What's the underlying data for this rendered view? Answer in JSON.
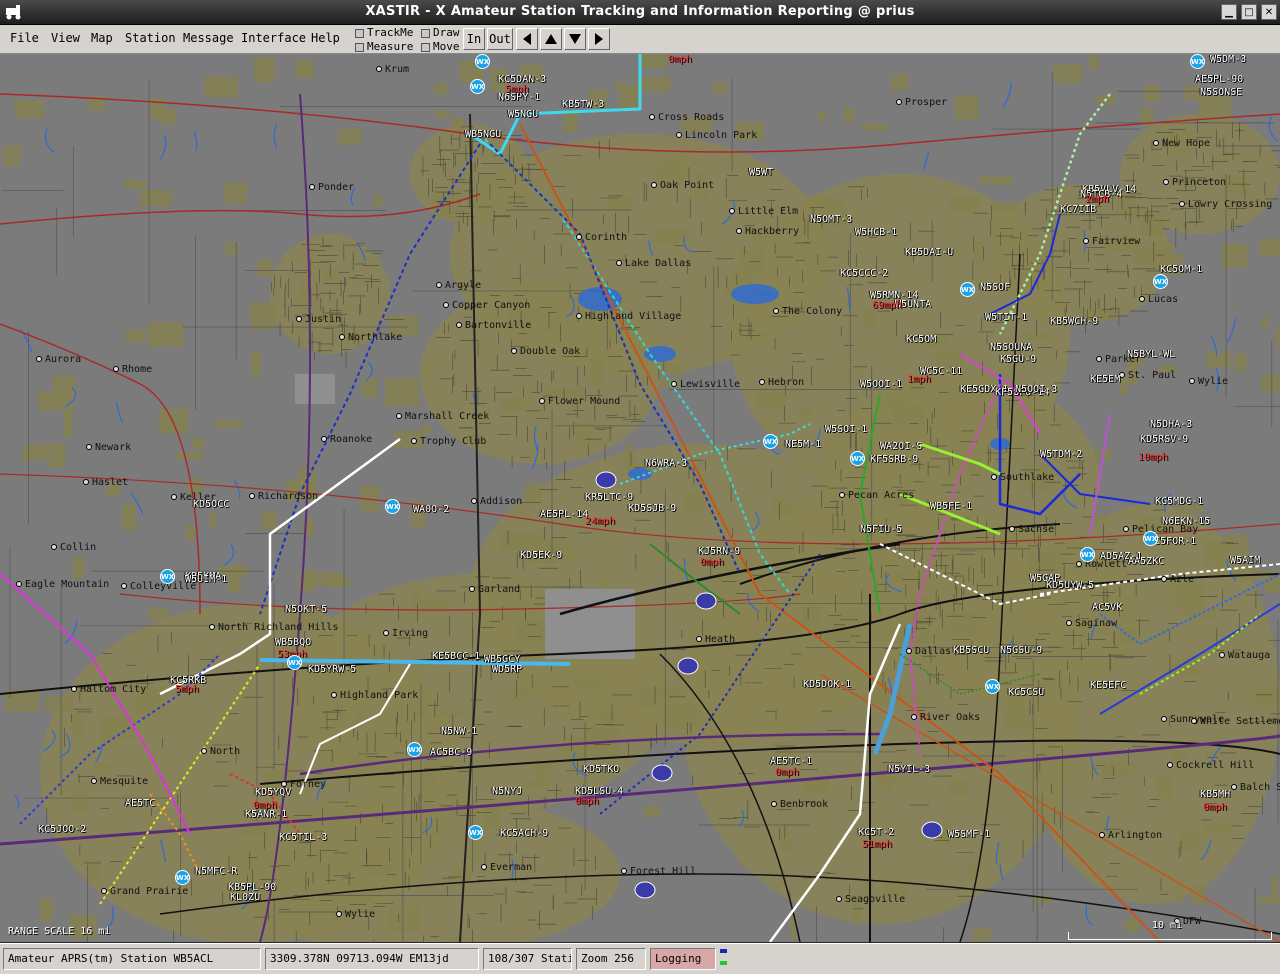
{
  "window": {
    "title": "XASTIR - X Amateur Station Tracking and Information Reporting @ prius"
  },
  "menu": [
    "File",
    "View",
    "Map",
    "Station",
    "Message",
    "Interface",
    "Help"
  ],
  "toggles": {
    "trackme": "TrackMe",
    "draw": "Draw",
    "measure": "Measure",
    "move": "Move"
  },
  "zoom": {
    "in": "In",
    "out": "Out"
  },
  "map": {
    "range_scale": "RANGE SCALE 16 mi",
    "scale_label": "10 mi",
    "towns": [
      "Krum",
      "Cross Roads",
      "Lincoln Park",
      "Prosper",
      "New Hope",
      "Princeton",
      "Lowry Crossing",
      "Ponder",
      "Oak Point",
      "Little Elm",
      "Hackberry",
      "Lake Dallas",
      "Fairview",
      "Lucas",
      "Corinth",
      "Argyle",
      "Copper Canyon",
      "Bartonville",
      "Justin",
      "Northlake",
      "Double Oak",
      "Highland Village",
      "The Colony",
      "Aurora",
      "Rhome",
      "Lewisville",
      "Hebron",
      "Parker",
      "St. Paul",
      "Wylie",
      "Flower Mound",
      "Marshall Creek",
      "Roanoke",
      "Trophy Club",
      "Newark",
      "Keller",
      "Southlake",
      "Addison",
      "Pecan Acres",
      "Haslet",
      "Richardson",
      "Sachse",
      "Pelican Bay",
      "Collin",
      "Rowlett",
      "Azle",
      "Eagle Mountain",
      "Colleyville",
      "Garland",
      "Saginaw",
      "North Richland Hills",
      "Irving",
      "Heath",
      "Watauga",
      "Haltom City",
      "Highland Park",
      "Dallas",
      "Sunnyvale",
      "River Oaks",
      "White Settlement",
      "North",
      "Mesquite",
      "Forney",
      "Cockrell Hill",
      "Balch Springs",
      "Benbrook",
      "Arlington",
      "Grand Prairie",
      "Everman",
      "Forest Hill",
      "Seagoville",
      "Wylie",
      "DFW"
    ],
    "stations": [
      "KC5DAN-3",
      "W5NGU",
      "KB5TW-3",
      "WB5NGU",
      "N6SPY-1",
      "W5HCB-1",
      "KB5DAI-U",
      "KC5CCC-2",
      "KC7IIB",
      "N5SOF",
      "W5UNTA",
      "W5RMN-14",
      "W5TIT-1",
      "KB5WCH-9",
      "KC5OM",
      "W5SOI-1",
      "KB5VLV-14",
      "N5TCB-4",
      "N5BYL-WL",
      "KC5OM-1",
      "N5SOUNA",
      "K5GU-9",
      "KE5EM",
      "W5OOI-1",
      "WC5C-11",
      "KE5GDX-1",
      "KF5SFO-14",
      "N5OOI-3",
      "N5DHA-3",
      "KD5RSV-9",
      "N6WRA-3",
      "NE5M-1",
      "WA2OI-S",
      "WA0O-2",
      "AE5PL-14",
      "KR5LTC-9",
      "KD5SJB-9",
      "KJ5RN-9",
      "WB5FE-1",
      "KD5OCC",
      "KF5SRB-9",
      "N5OKT-5",
      "WB5BQO",
      "KD5KMA",
      "KE5BCC-1",
      "KD5YRW-5",
      "WD5RP",
      "KC5RKB",
      "N5NW-1",
      "AC5BC-9",
      "WB5GCY",
      "KD5YQV",
      "KD5LSU-4",
      "KD5TKO",
      "AE5TC-1",
      "N5NYJ",
      "KC5ACH-9",
      "KC5T-2",
      "N5YIL-3",
      "W5SMF-1",
      "AC5VK",
      "KB5MH",
      "KD5DOK-1",
      "KC5CSU",
      "N5GSU-9",
      "KB5SCU",
      "KE5EFC",
      "KG5MDG-1",
      "AD5AZ-1",
      "N6EKN-15",
      "KC5FOR-1",
      "AA5ZKC",
      "W5GAP",
      "KD5UYW-5",
      "W5TDM-2",
      "W5AIM",
      "W5DM-3",
      "N5SONSE",
      "AE5PL-90",
      "N5MFC-R",
      "KB5PL-90",
      "KC5TIL-3",
      "KD5EK-9",
      "N5FIU-5",
      "KC5JOO-2",
      "AE5TC",
      "KL0ZU",
      "K5ANR-1",
      "W5UIM-1",
      "W5WT",
      "N5OMT-3"
    ],
    "speeds": [
      "0mph",
      "5mph",
      "2mph",
      "69mph",
      "24mph",
      "10mph",
      "1mph",
      "0mph",
      "5mph",
      "53mph",
      "0mph",
      "0mph",
      "0mph",
      "51mph",
      "0mph"
    ]
  },
  "status": {
    "station": "Amateur APRS(tm) Station WB5ACL",
    "coords": "3309.378N  09713.094W  EM13jd",
    "stations": "108/307 Stati",
    "zoom": "Zoom 256",
    "logging": "Logging"
  },
  "colors": {
    "map_bg": "#7b7b7b",
    "urban": "#8a8454",
    "wx": "#1aa3e8",
    "logging_bg": "#d8a8a8"
  }
}
